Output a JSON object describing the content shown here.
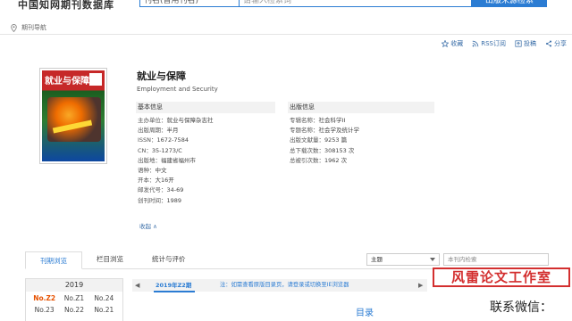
{
  "header": {
    "site_logo": "中国知网期刊数据库",
    "scope_select": "刊名(曾用刊名)",
    "search_placeholder": "请输入检索词",
    "search_button": "出版来源检索"
  },
  "breadcrumb": {
    "label": "期刊导航"
  },
  "actions": [
    {
      "label": "收藏",
      "icon": "star-icon"
    },
    {
      "label": "RSS订阅",
      "icon": "rss-icon"
    },
    {
      "label": "投稿",
      "icon": "submit-icon"
    },
    {
      "label": "分享",
      "icon": "share-icon"
    }
  ],
  "journal": {
    "title": "就业与保障",
    "title_en": "Employment and Security",
    "cover_text": "就业与保障"
  },
  "basic_info": {
    "heading": "基本信息",
    "rows": [
      {
        "label": "主办单位：",
        "value": "就业与保障杂志社"
      },
      {
        "label": "出版周期：",
        "value": "半月"
      },
      {
        "label": "ISSN：",
        "value": "1672-7584"
      },
      {
        "label": "CN：",
        "value": "35-1273/C"
      },
      {
        "label": "出版地：",
        "value": "福建省福州市"
      },
      {
        "label": "语种：",
        "value": "中文"
      },
      {
        "label": "开本：",
        "value": "大16开"
      },
      {
        "label": "邮发代号：",
        "value": "34-69"
      },
      {
        "label": "创刊时间：",
        "value": "1989"
      }
    ],
    "more": "收起 ∧"
  },
  "publish_info": {
    "heading": "出版信息",
    "rows": [
      {
        "label": "专辑名称：",
        "value": "社会科学II"
      },
      {
        "label": "专题名称：",
        "value": "社会学及统计学"
      },
      {
        "label": "出版文献量：",
        "value": "9253 篇"
      },
      {
        "label": "总下载次数：",
        "value": "308153 次"
      },
      {
        "label": "总被引次数：",
        "value": "1962 次"
      }
    ]
  },
  "tabs": [
    {
      "label": "刊期浏览",
      "active": true
    },
    {
      "label": "栏目浏览",
      "active": false
    },
    {
      "label": "统计与评价",
      "active": false
    }
  ],
  "search_field": {
    "selected": "主题",
    "placeholder": "本刊内检索"
  },
  "stamp_text": "风雷论文工作室",
  "year_panel": {
    "year": "2019",
    "issues": [
      "No.Z2",
      "No.Z1",
      "No.24",
      "No.23",
      "No.22",
      "No.21"
    ],
    "current": "No.Z2"
  },
  "issue_nav": {
    "left": "◀",
    "current_issue": "2019年Z2期",
    "note": "注：如需查看原版目录页，请登录或切换至IE浏览器",
    "right": "▶"
  },
  "toc_title": "目录",
  "wechat_label": "联系微信：",
  "colors": {
    "accent": "#2b7cd3",
    "current_issue": "#e65100",
    "stamp": "#d32f2f"
  }
}
